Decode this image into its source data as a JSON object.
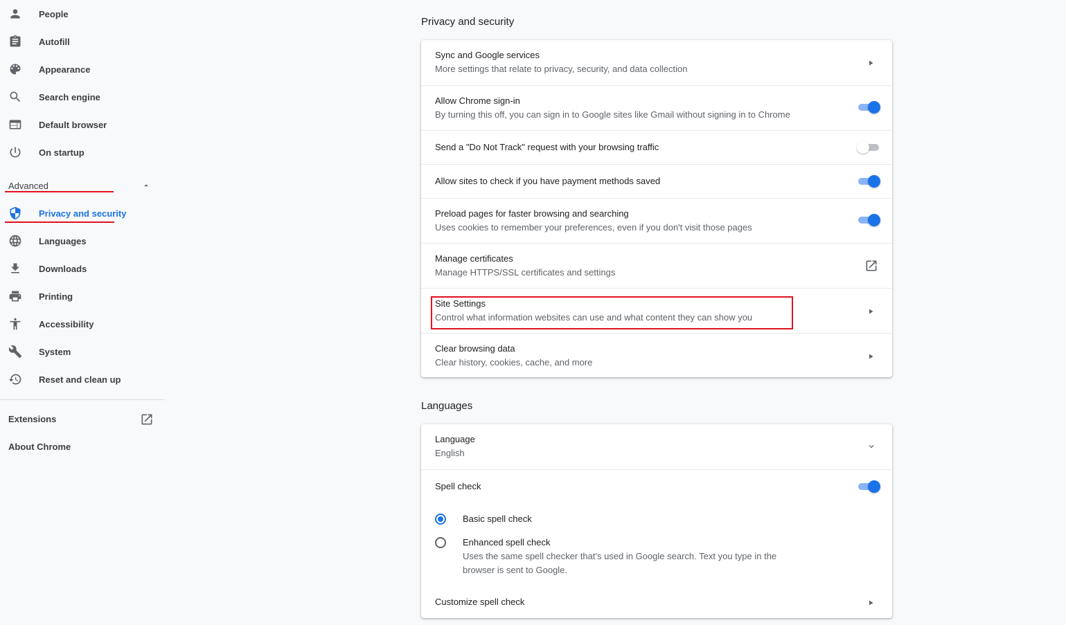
{
  "sidebar": {
    "items": [
      {
        "label": "People",
        "icon": "person-icon"
      },
      {
        "label": "Autofill",
        "icon": "clipboard-icon"
      },
      {
        "label": "Appearance",
        "icon": "palette-icon"
      },
      {
        "label": "Search engine",
        "icon": "search-icon"
      },
      {
        "label": "Default browser",
        "icon": "browser-icon"
      },
      {
        "label": "On startup",
        "icon": "power-icon"
      }
    ],
    "advanced_label": "Advanced",
    "advanced_items": [
      {
        "label": "Privacy and security",
        "icon": "shield-icon",
        "active": true
      },
      {
        "label": "Languages",
        "icon": "globe-icon"
      },
      {
        "label": "Downloads",
        "icon": "download-icon"
      },
      {
        "label": "Printing",
        "icon": "printer-icon"
      },
      {
        "label": "Accessibility",
        "icon": "accessibility-icon"
      },
      {
        "label": "System",
        "icon": "wrench-icon"
      },
      {
        "label": "Reset and clean up",
        "icon": "history-icon"
      }
    ],
    "extensions_label": "Extensions",
    "about_label": "About Chrome",
    "accent_color": "#1a73e8",
    "annotation_color": "#e0121e"
  },
  "privacy": {
    "title": "Privacy and security",
    "rows": [
      {
        "title": "Sync and Google services",
        "subtitle": "More settings that relate to privacy, security, and data collection",
        "control": "arrow"
      },
      {
        "title": "Allow Chrome sign-in",
        "subtitle": "By turning this off, you can sign in to Google sites like Gmail without signing in to Chrome",
        "control": "toggle-on"
      },
      {
        "title": "Send a \"Do Not Track\" request with your browsing traffic",
        "control": "toggle-off"
      },
      {
        "title": "Allow sites to check if you have payment methods saved",
        "control": "toggle-on"
      },
      {
        "title": "Preload pages for faster browsing and searching",
        "subtitle": "Uses cookies to remember your preferences, even if you don't visit those pages",
        "control": "toggle-on"
      },
      {
        "title": "Manage certificates",
        "subtitle": "Manage HTTPS/SSL certificates and settings",
        "control": "open-in-new"
      },
      {
        "title": "Site Settings",
        "subtitle": "Control what information websites can use and what content they can show you",
        "control": "arrow"
      },
      {
        "title": "Clear browsing data",
        "subtitle": "Clear history, cookies, cache, and more",
        "control": "arrow"
      }
    ]
  },
  "languages": {
    "title": "Languages",
    "language_label": "Language",
    "language_value": "English",
    "spell_check_label": "Spell check",
    "spell_check_on": true,
    "basic_label": "Basic spell check",
    "enhanced_label": "Enhanced spell check",
    "enhanced_desc_1": "Uses the same spell checker that's used in Google search. Text you type in the",
    "enhanced_desc_2": "browser is sent to Google.",
    "customize_label": "Customize spell check",
    "selected_option": "basic"
  }
}
